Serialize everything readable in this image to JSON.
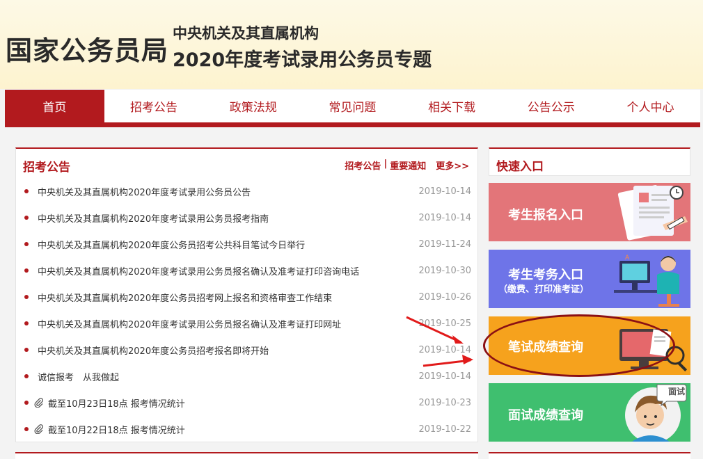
{
  "header": {
    "site_name": "国家公务员局",
    "subtitle_line1": "中央机关及其直属机构",
    "subtitle_line2": "2020年度考试录用公务员专题"
  },
  "nav": {
    "items": [
      "首页",
      "招考公告",
      "政策法规",
      "常见问题",
      "相关下载",
      "公告公示",
      "个人中心"
    ],
    "active_index": 0
  },
  "announcements": {
    "title": "招考公告",
    "link_announcements": "招考公告",
    "separator": "|",
    "link_notices": "重要通知",
    "more": "更多>>",
    "items": [
      {
        "text": "中央机关及其直属机构2020年度考试录用公务员公告",
        "date": "2019-10-14",
        "icon": "bullet"
      },
      {
        "text": "中央机关及其直属机构2020年度考试录用公务员报考指南",
        "date": "2019-10-14",
        "icon": "bullet"
      },
      {
        "text": "中央机关及其直属机构2020年度公务员招考公共科目笔试今日举行",
        "date": "2019-11-24",
        "icon": "bullet"
      },
      {
        "text": "中央机关及其直属机构2020年度考试录用公务员报名确认及准考证打印咨询电话",
        "date": "2019-10-30",
        "icon": "bullet"
      },
      {
        "text": "中央机关及其直属机构2020年度公务员招考网上报名和资格审查工作结束",
        "date": "2019-10-26",
        "icon": "bullet"
      },
      {
        "text": "中央机关及其直属机构2020年度考试录用公务员报名确认及准考证打印网址",
        "date": "2019-10-25",
        "icon": "bullet"
      },
      {
        "text": "中央机关及其直属机构2020年度公务员招考报名即将开始",
        "date": "2019-10-14",
        "icon": "bullet"
      },
      {
        "text": "诚信报考　从我做起",
        "date": "2019-10-14",
        "icon": "bullet"
      },
      {
        "text": "截至10月23日18点 报考情况统计",
        "date": "2019-10-23",
        "icon": "paperclip-icon"
      },
      {
        "text": "截至10月22日18点 报考情况统计",
        "date": "2019-10-22",
        "icon": "paperclip-icon"
      }
    ]
  },
  "quick_access": {
    "title": "快速入口",
    "registration": "考生报名入口",
    "exam_affairs": "考生考务入口",
    "exam_affairs_sub": "（缴费、打印准考证）",
    "written_scores": "笔试成绩查询",
    "interview_scores": "面试成绩查询",
    "interview_badge": "面试"
  },
  "colors": {
    "brand_red": "#b21a1e",
    "registration_bg": "#e37579",
    "exam_affairs_bg": "#6e74e8",
    "written_scores_bg": "#f6a21d",
    "interview_scores_bg": "#3fbf6f"
  }
}
